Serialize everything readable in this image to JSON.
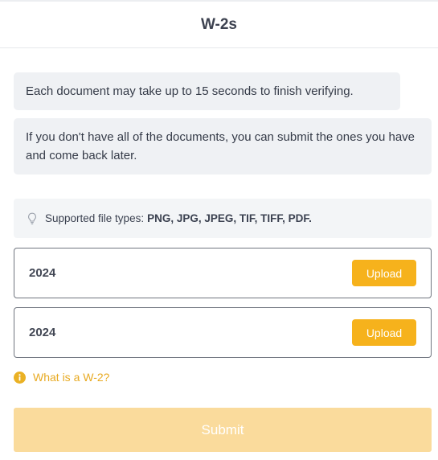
{
  "header": {
    "title": "W-2s"
  },
  "notices": [
    "Each document may take up to 15 seconds to finish verifying.",
    "If you don't have all of the documents, you can submit the ones you have and come back later."
  ],
  "file_types": {
    "icon": "lightbulb-icon",
    "label": "Supported file types:",
    "types": "PNG, JPG, JPEG, TIF, TIFF, PDF."
  },
  "documents": [
    {
      "year": "2024",
      "upload_label": "Upload"
    },
    {
      "year": "2024",
      "upload_label": "Upload"
    }
  ],
  "help_link": {
    "icon": "info-icon",
    "label": "What is a W-2?"
  },
  "submit": {
    "label": "Submit",
    "disabled": true
  },
  "colors": {
    "accent": "#f6b21c",
    "accent_disabled": "#fadb9c",
    "link": "#e8aa22",
    "notice_bg": "#eff1f4"
  }
}
